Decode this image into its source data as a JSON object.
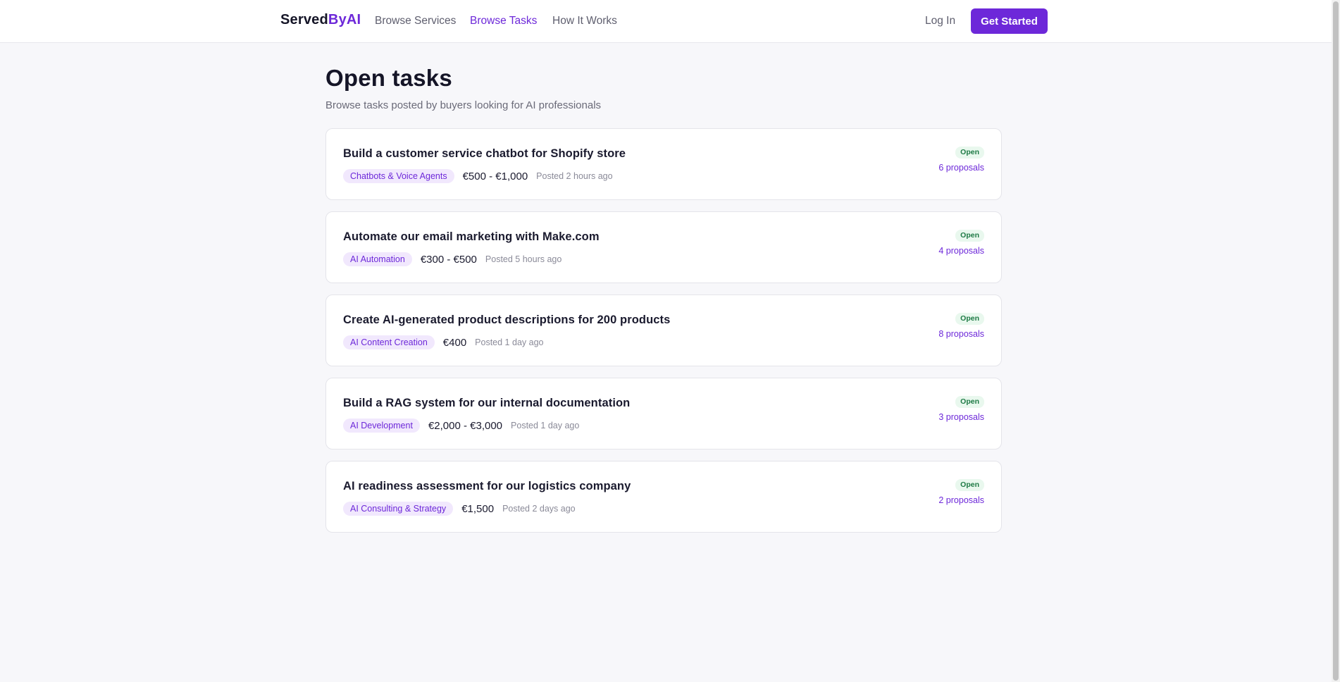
{
  "header": {
    "logo_main": "Served",
    "logo_accent": "ByAI",
    "nav": [
      {
        "label": "Browse Services"
      },
      {
        "label": "Browse Tasks"
      },
      {
        "label": "How It Works"
      }
    ],
    "active_nav": "Browse Tasks",
    "login_label": "Log In",
    "cta_label": "Get Started"
  },
  "main": {
    "title": "Open tasks",
    "subtitle": "Browse tasks posted by buyers looking for AI professionals",
    "tasks": [
      {
        "title": "Build a customer service chatbot for Shopify store",
        "category": "Chatbots & Voice Agents",
        "budget": "€500 - €1,000",
        "posted": "Posted 2 hours ago",
        "status": "Open",
        "proposals": "6 proposals"
      },
      {
        "title": "Automate our email marketing with Make.com",
        "category": "AI Automation",
        "budget": "€300 - €500",
        "posted": "Posted 5 hours ago",
        "status": "Open",
        "proposals": "4 proposals"
      },
      {
        "title": "Create AI-generated product descriptions for 200 products",
        "category": "AI Content Creation",
        "budget": "€400",
        "posted": "Posted 1 day ago",
        "status": "Open",
        "proposals": "8 proposals"
      },
      {
        "title": "Build a RAG system for our internal documentation",
        "category": "AI Development",
        "budget": "€2,000 - €3,000",
        "posted": "Posted 1 day ago",
        "status": "Open",
        "proposals": "3 proposals"
      },
      {
        "title": "AI readiness assessment for our logistics company",
        "category": "AI Consulting & Strategy",
        "budget": "€1,500",
        "posted": "Posted 2 days ago",
        "status": "Open",
        "proposals": "2 proposals"
      }
    ]
  },
  "colors": {
    "accent": "#6d28d9",
    "status_open_bg": "#e9f8ee",
    "status_open_text": "#1e7a45",
    "page_bg": "#f7f7fa"
  }
}
